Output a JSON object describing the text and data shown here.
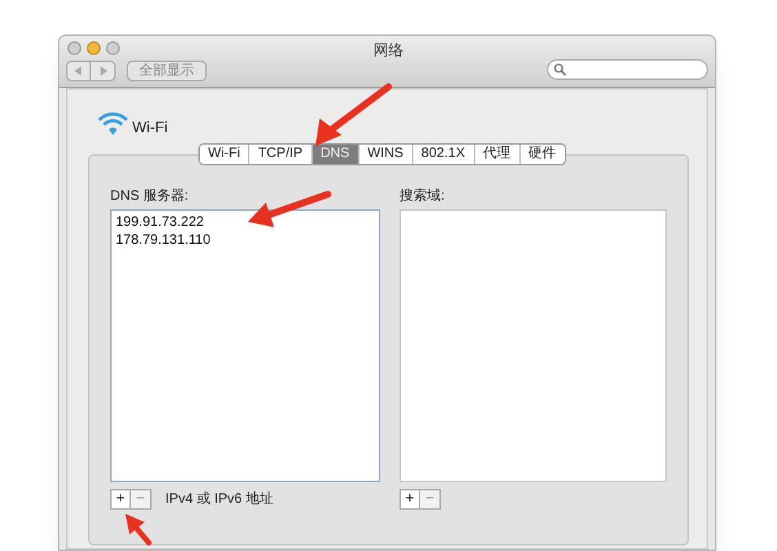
{
  "window": {
    "title": "网络",
    "show_all_button": "全部显示"
  },
  "service": {
    "name": "Wi-Fi"
  },
  "tabs": [
    {
      "label": "Wi-Fi",
      "selected": false
    },
    {
      "label": "TCP/IP",
      "selected": false
    },
    {
      "label": "DNS",
      "selected": true
    },
    {
      "label": "WINS",
      "selected": false
    },
    {
      "label": "802.1X",
      "selected": false
    },
    {
      "label": "代理",
      "selected": false
    },
    {
      "label": "硬件",
      "selected": false
    }
  ],
  "dns_servers": {
    "label": "DNS 服务器:",
    "items": [
      "199.91.73.222",
      "178.79.131.110"
    ],
    "hint": "IPv4 或 IPv6 地址"
  },
  "search_domains": {
    "label": "搜索域:"
  },
  "add_button": "+",
  "remove_button": "−"
}
